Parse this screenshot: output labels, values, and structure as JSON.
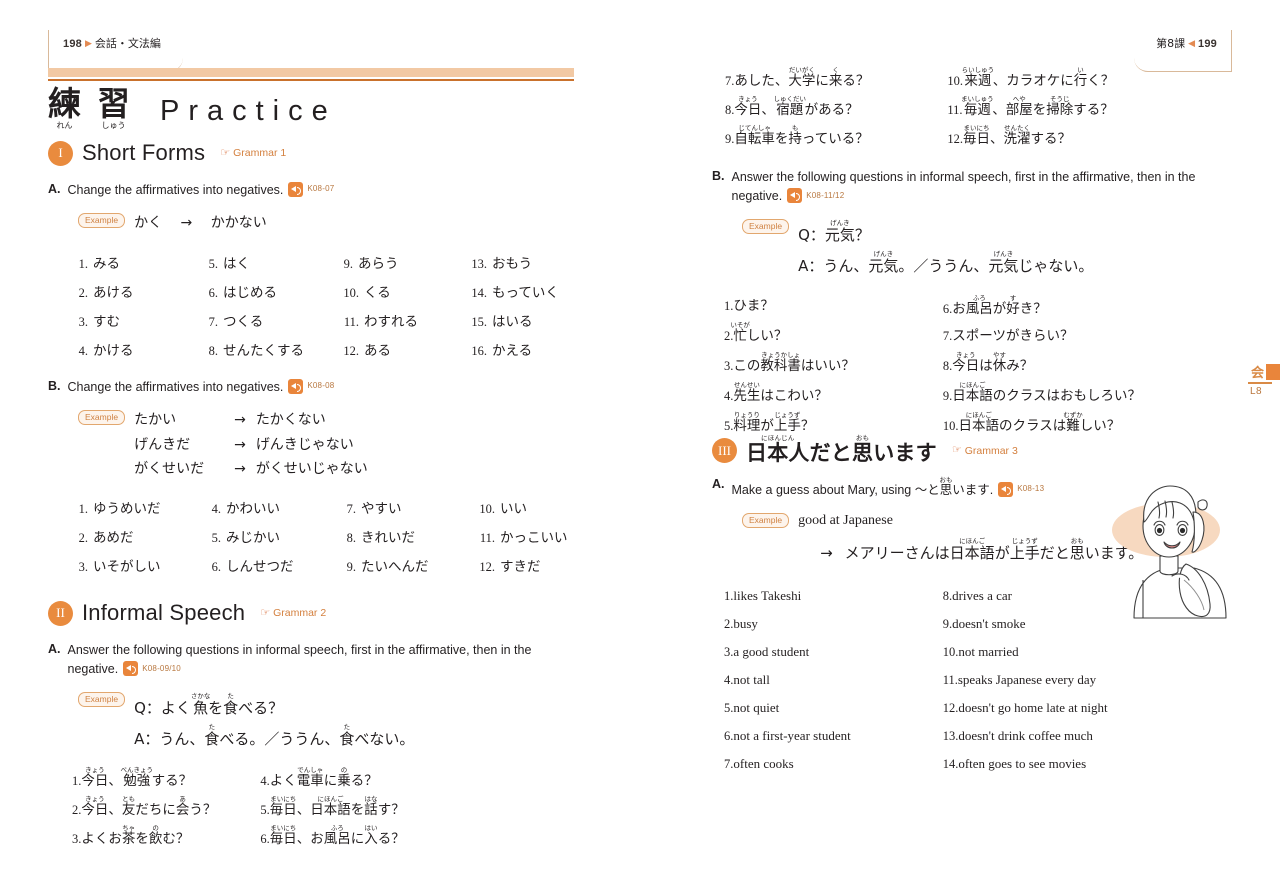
{
  "document": {
    "title": "Genki Lesson 8 Practice",
    "accent_color": "#e9853b",
    "banner_color": "#f2c9a4",
    "rule_color": "#c9712c"
  },
  "left_page": {
    "running_head": {
      "page_number": "198",
      "marker": "▶",
      "section_name": "会話・文法編"
    },
    "banner": {
      "kanji": [
        {
          "char": "練",
          "ruby": "れん"
        },
        {
          "char": "習",
          "ruby": "しゅう"
        }
      ],
      "english": "Practice"
    },
    "sections": [
      {
        "numeral": "I",
        "title": "Short Forms",
        "grammar_ref": "Grammar 1",
        "subsections": [
          {
            "letter": "A.",
            "instruction": "Change the affirmatives into negatives.",
            "audio": "K08-07",
            "example_tag": "Example",
            "example_lines": [
              {
                "left": "かく",
                "arrow": "→",
                "right": "かかない"
              }
            ],
            "columns": 4,
            "items": [
              "みる",
              "あける",
              "すむ",
              "かける",
              "はく",
              "はじめる",
              "つくる",
              "せんたくする",
              "あらう",
              "くる",
              "わすれる",
              "ある",
              "おもう",
              "もっていく",
              "はいる",
              "かえる"
            ]
          },
          {
            "letter": "B.",
            "instruction": "Change the affirmatives into negatives.",
            "audio": "K08-08",
            "example_tag": "Example",
            "example_lines": [
              {
                "left": "たかい",
                "arrow": "→",
                "right": "たかくない"
              },
              {
                "left": "げんきだ",
                "arrow": "→",
                "right": "げんきじゃない"
              },
              {
                "left": "がくせいだ",
                "arrow": "→",
                "right": "がくせいじゃない"
              }
            ],
            "columns": 4,
            "items": [
              "ゆうめいだ",
              "あめだ",
              "いそがしい",
              "かわいい",
              "みじかい",
              "しんせつだ",
              "やすい",
              "きれいだ",
              "たいへんだ",
              "いい",
              "かっこいい",
              "すきだ"
            ]
          }
        ]
      },
      {
        "numeral": "II",
        "title": "Informal Speech",
        "grammar_ref": "Grammar 2",
        "subsections": [
          {
            "letter": "A.",
            "instruction": "Answer the following questions in informal speech, first in the affirmative, then in the negative.",
            "audio": "K08-09/10",
            "example_tag": "Example",
            "example_qa": [
              "Q：よく魚を食べる？",
              "A：うん、食べる。／ううん、食べない。"
            ],
            "items_left": [
              "今日、勉強する？",
              "今日、友だちに会う？",
              "よくお茶を飲む？"
            ],
            "items_right": [
              "よく電車に乗る？",
              "毎日、日本語を話す？",
              "毎日、お風呂に入る？"
            ]
          }
        ]
      }
    ]
  },
  "right_page": {
    "running_head": {
      "lesson": "第8課",
      "marker": "◀",
      "page_number": "199"
    },
    "continued_items_left": [
      "あした、大学に来る？",
      "今日、宿題がある？",
      "自転車を持っている？"
    ],
    "continued_items_right": [
      "来週、カラオケに行く？",
      "毎週、部屋を掃除する？",
      "毎日、洗濯する？"
    ],
    "subsection_b": {
      "letter": "B.",
      "instruction": "Answer the following questions in informal speech, first in the affirmative, then in the negative.",
      "audio": "K08-11/12",
      "example_tag": "Example",
      "example_qa": [
        "Q：元気？",
        "A：うん、元気。／ううん、元気じゃない。"
      ],
      "items_left": [
        "ひま？",
        "忙しい？",
        "この教科書はいい？",
        "先生はこわい？",
        "料理が上手？"
      ],
      "items_right": [
        "お風呂が好き？",
        "スポーツがきらい？",
        "今日は休み？",
        "日本語のクラスはおもしろい？",
        "日本語のクラスは難しい？"
      ]
    },
    "section_three": {
      "numeral": "III",
      "title": "日本人だと思います",
      "grammar_ref": "Grammar 3",
      "subsection": {
        "letter": "A.",
        "instruction": "Make a guess about Mary, using ～と思います.",
        "audio": "K08-13",
        "example_tag": "Example",
        "example_prompt": "good at Japanese",
        "example_arrow": "→",
        "example_answer": "メアリーさんは日本語が上手だと思います。",
        "items_left": [
          "likes Takeshi",
          "busy",
          "a good student",
          "not tall",
          "not quiet",
          "not a first-year student",
          "often cooks"
        ],
        "items_right": [
          "drives a car",
          "doesn't smoke",
          "not married",
          "speaks Japanese every day",
          "doesn't go home late at night",
          "doesn't drink coffee much",
          "often goes to see movies"
        ]
      }
    },
    "side_tab": {
      "kanji": "会",
      "lesson_label": "L8"
    },
    "illustration": {
      "name": "mary-with-bag",
      "background_color": "#f7d9c0"
    }
  }
}
